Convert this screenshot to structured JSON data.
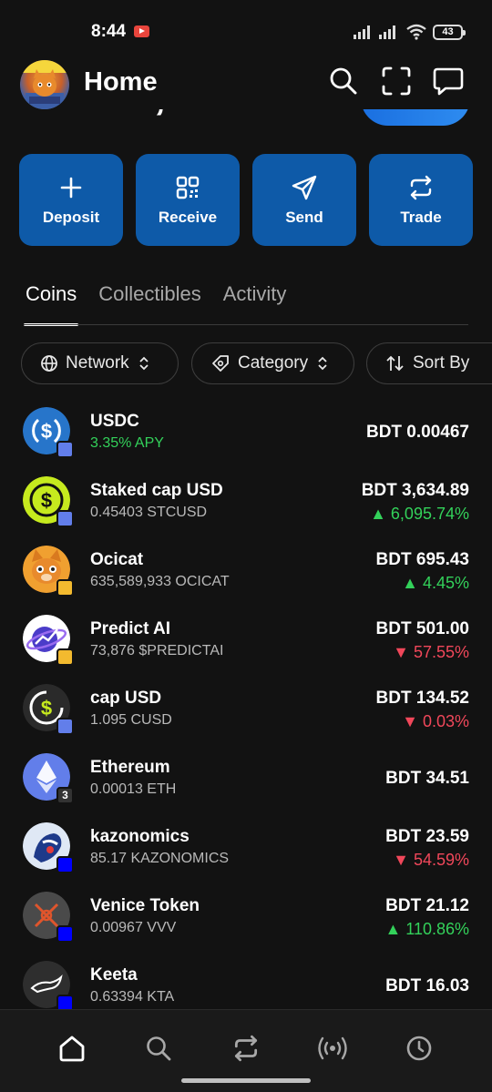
{
  "status": {
    "time": "8:44",
    "battery": "43"
  },
  "header": {
    "title": "Home"
  },
  "actions": [
    {
      "label": "Deposit",
      "icon": "plus-icon"
    },
    {
      "label": "Receive",
      "icon": "qr-code-icon"
    },
    {
      "label": "Send",
      "icon": "paper-plane-icon"
    },
    {
      "label": "Trade",
      "icon": "swap-arrows-icon"
    }
  ],
  "tabs": [
    {
      "label": "Coins",
      "active": true
    },
    {
      "label": "Collectibles",
      "active": false
    },
    {
      "label": "Activity",
      "active": false
    }
  ],
  "filters": [
    {
      "label": "Network",
      "icon": "globe-icon"
    },
    {
      "label": "Category",
      "icon": "tag-icon"
    },
    {
      "label": "Sort By",
      "icon": "sort-icon"
    }
  ],
  "coins": [
    {
      "name": "USDC",
      "sub": "3.35% APY",
      "sub_is_apy": true,
      "value": "BDT 0.00467",
      "change": "",
      "direction": "",
      "icon": "usdc-icon",
      "color": "#2775ca",
      "badge": "ethereum-badge",
      "badge_color": "#627eea"
    },
    {
      "name": "Staked cap USD",
      "sub": "0.45403 STCUSD",
      "value": "BDT 3,634.89",
      "change": "6,095.74%",
      "direction": "up",
      "icon": "staked-cap-usd-icon",
      "color": "#c6ea1e",
      "badge": "ethereum-badge",
      "badge_color": "#627eea"
    },
    {
      "name": "Ocicat",
      "sub": "635,589,933 OCICAT",
      "value": "BDT 695.43",
      "change": "4.45%",
      "direction": "up",
      "icon": "ocicat-icon",
      "color": "#f0a030",
      "badge": "bnb-badge",
      "badge_color": "#f3ba2f"
    },
    {
      "name": "Predict AI",
      "sub": "73,876 $PREDICTAI",
      "value": "BDT 501.00",
      "change": "57.55%",
      "direction": "down",
      "icon": "predict-ai-icon",
      "color": "#ffffff",
      "badge": "bnb-badge",
      "badge_color": "#f3ba2f"
    },
    {
      "name": "cap USD",
      "sub": "1.095 CUSD",
      "value": "BDT 134.52",
      "change": "0.03%",
      "direction": "down",
      "icon": "cap-usd-icon",
      "color": "#2a2a2a",
      "badge": "ethereum-badge",
      "badge_color": "#627eea"
    },
    {
      "name": "Ethereum",
      "sub": "0.00013 ETH",
      "value": "BDT 34.51",
      "change": "",
      "direction": "",
      "icon": "ethereum-icon",
      "color": "#627eea",
      "badge": "chain-count-badge",
      "badge_text": "3",
      "badge_color": "#333333"
    },
    {
      "name": "kazonomics",
      "sub": "85.17 KAZONOMICS",
      "value": "BDT 23.59",
      "change": "54.59%",
      "direction": "down",
      "icon": "kazonomics-icon",
      "color": "#dfe8f5",
      "badge": "base-badge",
      "badge_color": "#0000ff"
    },
    {
      "name": "Venice Token",
      "sub": "0.00967 VVV",
      "value": "BDT 21.12",
      "change": "110.86%",
      "direction": "up",
      "icon": "venice-token-icon",
      "color": "#4a4a4a",
      "badge": "base-badge",
      "badge_color": "#0000ff"
    },
    {
      "name": "Keeta",
      "sub": "0.63394 KTA",
      "value": "BDT 16.03",
      "change": "",
      "direction": "",
      "icon": "keeta-icon",
      "color": "#2e2e2e",
      "badge": "base-badge",
      "badge_color": "#0000ff"
    }
  ],
  "bottom_nav": [
    {
      "name": "home-icon",
      "active": true
    },
    {
      "name": "search-icon",
      "active": false
    },
    {
      "name": "swap-icon",
      "active": false
    },
    {
      "name": "broadcast-icon",
      "active": false
    },
    {
      "name": "history-icon",
      "active": false
    }
  ],
  "colors": {
    "background": "#121212",
    "button": "#0e5aa8",
    "positive": "#33d15a",
    "negative": "#f0475a"
  }
}
